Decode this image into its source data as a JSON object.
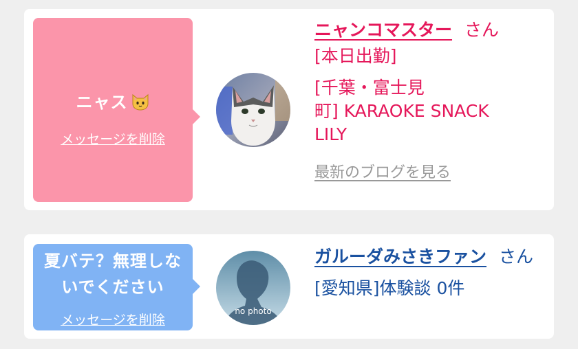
{
  "messages": [
    {
      "bubble_text": "ニャス",
      "bubble_emoji_icon": "cat-face-icon",
      "bubble_color": "#fb95aa",
      "delete_label": "メッセージを削除",
      "user_name": "ニャンコマスター",
      "honorific": "さん",
      "name_color": "#e5175a",
      "status": "[本日出勤]",
      "shop_line1": "[千葉・富士見",
      "shop_line2": "町] KARAOKE SNACK",
      "shop_line3": "LILY",
      "blog_link": "最新のブログを見る",
      "avatar_icon": "cat-photo"
    },
    {
      "bubble_text": "夏バテ？無理しないでください",
      "bubble_color": "#80b3f4",
      "delete_label": "メッセージを削除",
      "user_name": "ガルーダみさきファン",
      "honorific": "さん",
      "name_color": "#1a51a0",
      "region": "[愛知県]体験談 0件",
      "avatar_text": "no photo",
      "avatar_icon": "no-photo-silhouette"
    }
  ]
}
